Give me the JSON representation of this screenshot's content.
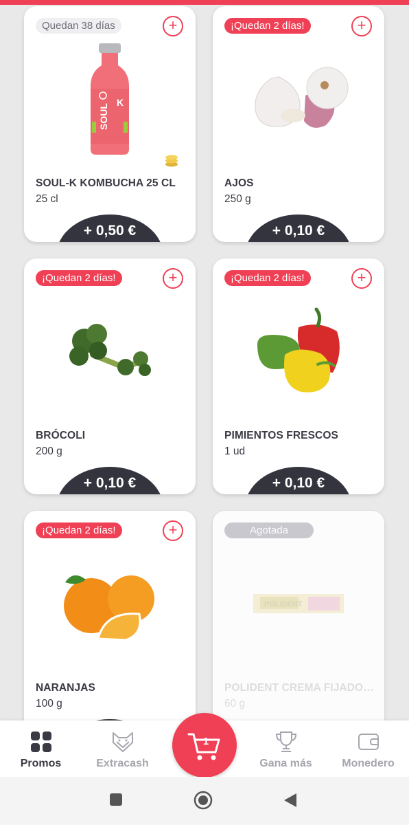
{
  "products": [
    {
      "badge": "Quedan 38 días",
      "badge_style": "gray",
      "name": "SOUL-K KOMBUCHA 25 CL",
      "qty": "25 cl",
      "price": "+ 0,50 €",
      "image": "kombucha-bottle-image",
      "add_icon": "plus-circle-icon"
    },
    {
      "badge": "¡Quedan 2 días!",
      "badge_style": "red",
      "name": "AJOS",
      "qty": "250 g",
      "price": "+ 0,10 €",
      "image": "garlic-image",
      "add_icon": "plus-circle-icon"
    },
    {
      "badge": "¡Quedan 2 días!",
      "badge_style": "red",
      "name": "BRÓCOLI",
      "qty": "200 g",
      "price": "+ 0,10 €",
      "image": "broccoli-image",
      "add_icon": "plus-circle-icon"
    },
    {
      "badge": "¡Quedan 2 días!",
      "badge_style": "red",
      "name": "PIMIENTOS FRESCOS",
      "qty": "1 ud",
      "price": "+ 0,10 €",
      "image": "peppers-image",
      "add_icon": "plus-circle-icon"
    },
    {
      "badge": "¡Quedan 2 días!",
      "badge_style": "red",
      "name": "NARANJAS",
      "qty": "100 g",
      "price": "",
      "image": "oranges-image",
      "add_icon": "plus-circle-icon"
    },
    {
      "badge": "Agotada",
      "badge_style": "out",
      "name": "POLIDENT CREMA FIJADO…",
      "qty": "60 g",
      "price": "",
      "image": "polident-box-image",
      "image_text": "POLIDENT"
    }
  ],
  "nav": {
    "promos": "Promos",
    "extracash": "Extracash",
    "cart_count": "1",
    "gana_mas": "Gana más",
    "monedero": "Monedero"
  },
  "colors": {
    "accent": "#ef4055",
    "dark": "#34343e",
    "inactive": "#a6a6ae"
  }
}
